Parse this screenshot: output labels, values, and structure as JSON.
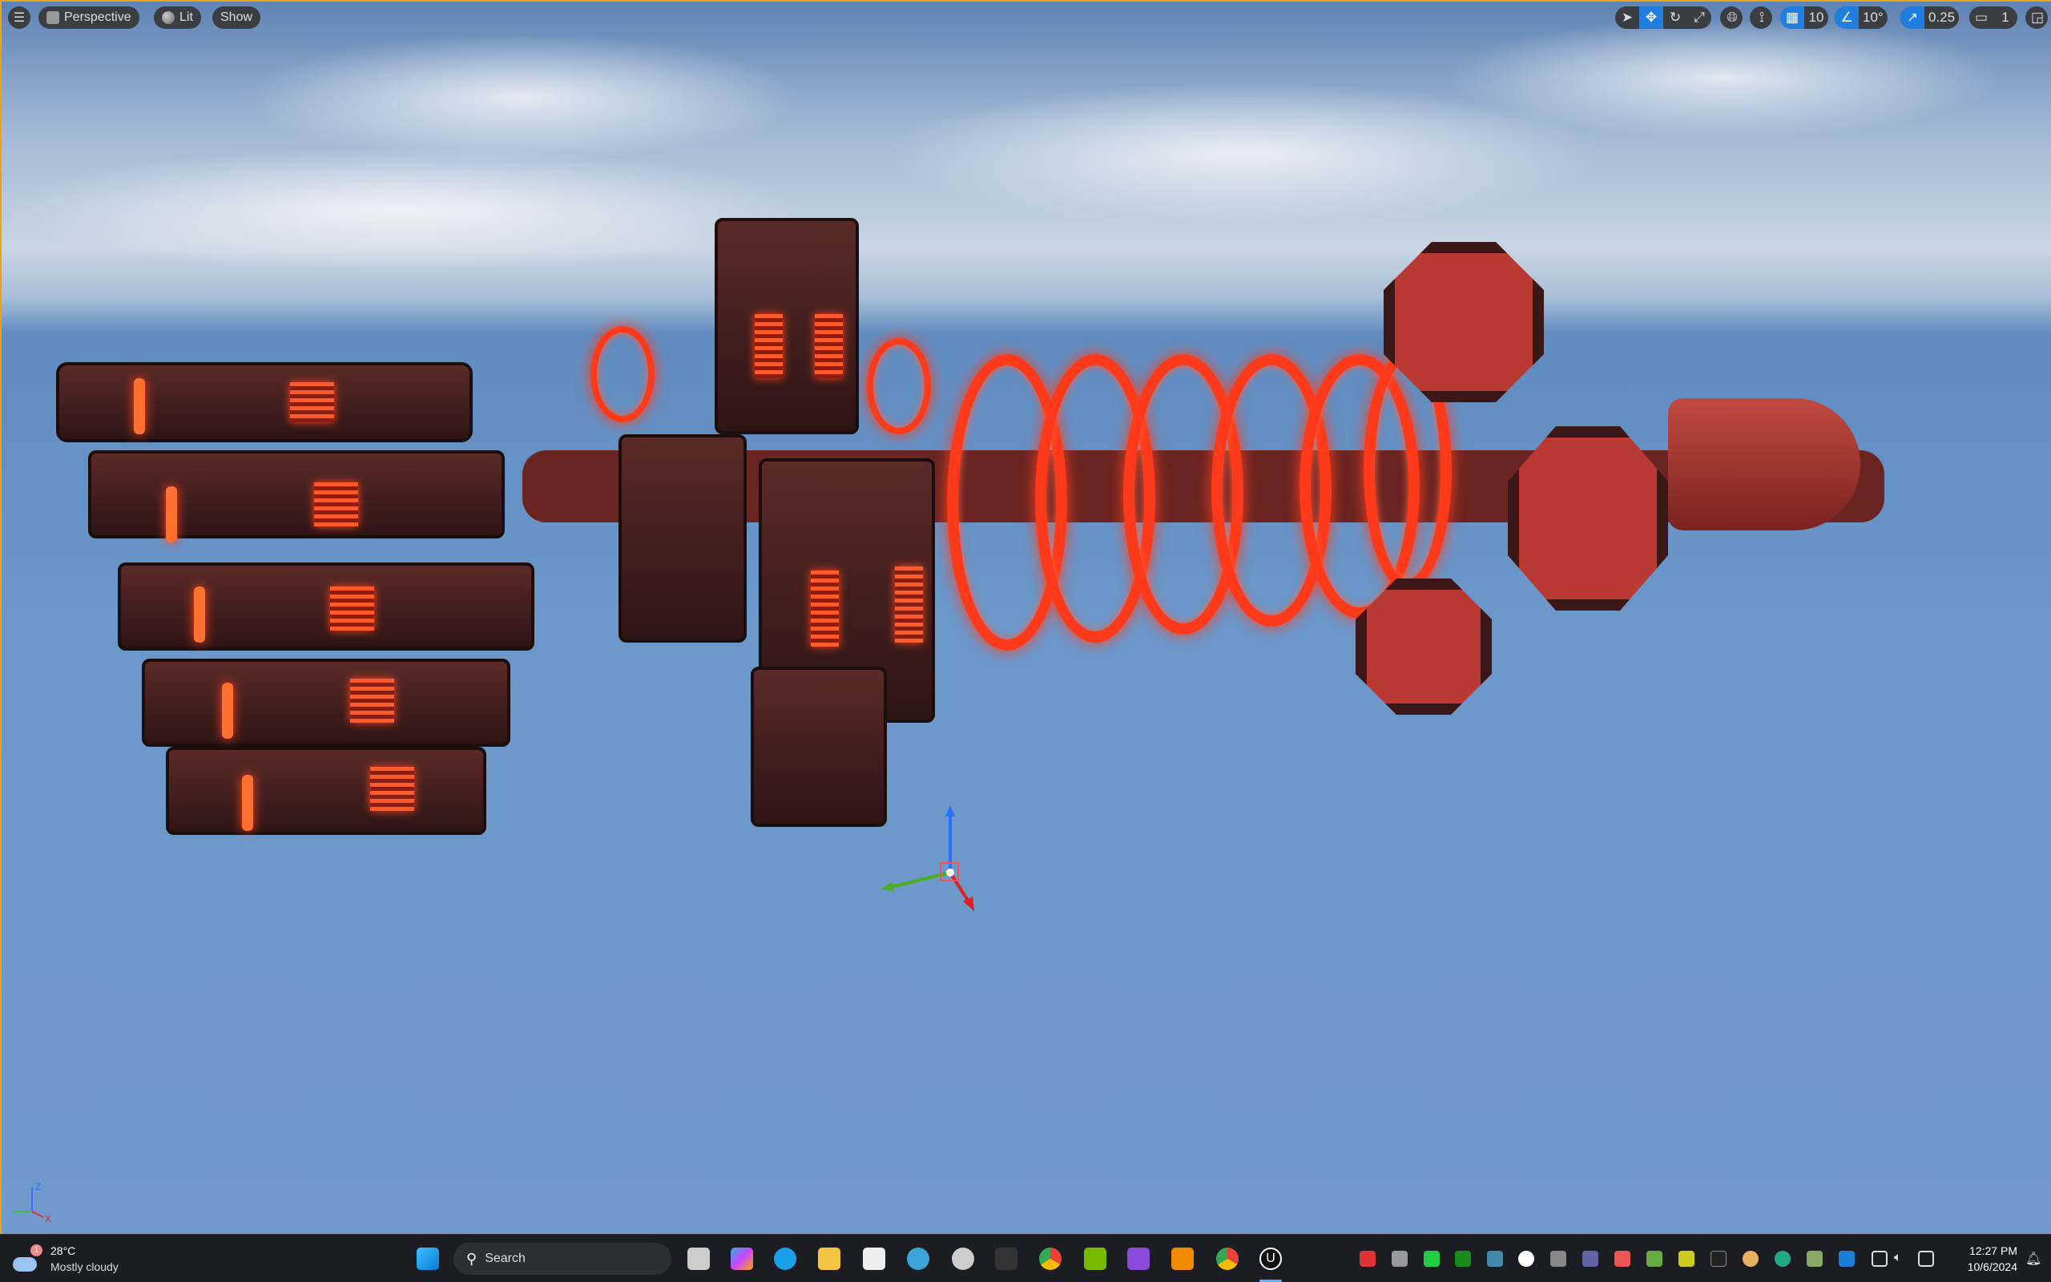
{
  "viewport_toolbar": {
    "menu_icon": "hamburger-icon",
    "view_mode": "Perspective",
    "lighting_mode": "Lit",
    "show_label": "Show",
    "grid_snap_value": "10",
    "rotation_snap_value": "10°",
    "scale_snap_value": "0.25",
    "camera_speed_value": "1",
    "transform_tools": [
      "select",
      "translate",
      "rotate",
      "scale"
    ],
    "accent_color": "#1f7ee0"
  },
  "taskbar": {
    "weather": {
      "badge": "1",
      "temperature": "28°C",
      "condition": "Mostly cloudy"
    },
    "search_placeholder": "Search",
    "clock": {
      "time": "12:27 PM",
      "date": "10/6/2024"
    }
  }
}
